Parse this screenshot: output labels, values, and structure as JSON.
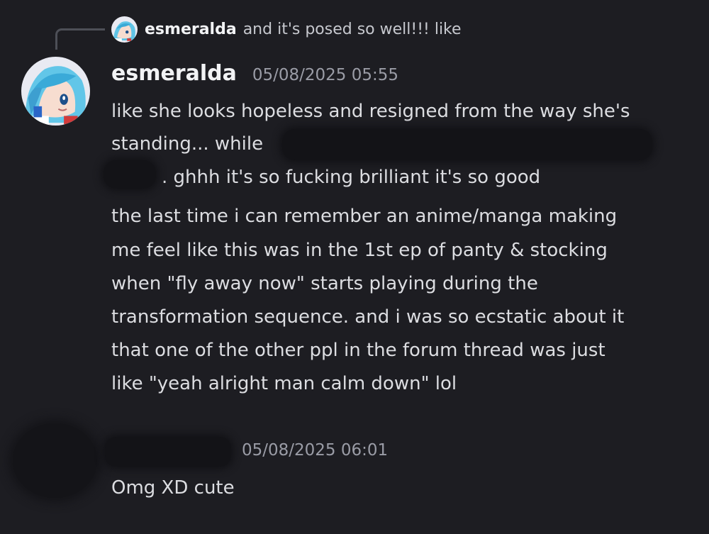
{
  "reply": {
    "author": "esmeralda",
    "snippet": "and it's posed so well!!! like"
  },
  "message1": {
    "author": "esmeralda",
    "timestamp": "05/08/2025 05:55",
    "paragraph1": [
      "like she looks hopeless and resigned from the way she's",
      "standing... while",
      ". ghhh it's so fucking brilliant it's so good"
    ],
    "paragraph2": [
      "the last time i can remember an anime/manga making",
      "me feel like this was in the 1st ep of panty & stocking",
      "when \"fly away now\" starts playing during the",
      "transformation sequence. and i was so ecstatic about it",
      "that one of the other ppl in the forum thread was just",
      "like \"yeah alright man calm down\" lol"
    ]
  },
  "message2": {
    "timestamp": "05/08/2025 06:01",
    "text": "Omg XD cute"
  },
  "colors": {
    "background": "#1d1d22",
    "username": "#f2f3f5",
    "body_text": "#dcdde1",
    "timestamp": "#9a9ca6",
    "redaction": "#131317",
    "reply_spine": "#4d4f57"
  },
  "icons": {
    "reply_avatar": "avatar-icon",
    "author_avatar": "avatar-icon"
  }
}
